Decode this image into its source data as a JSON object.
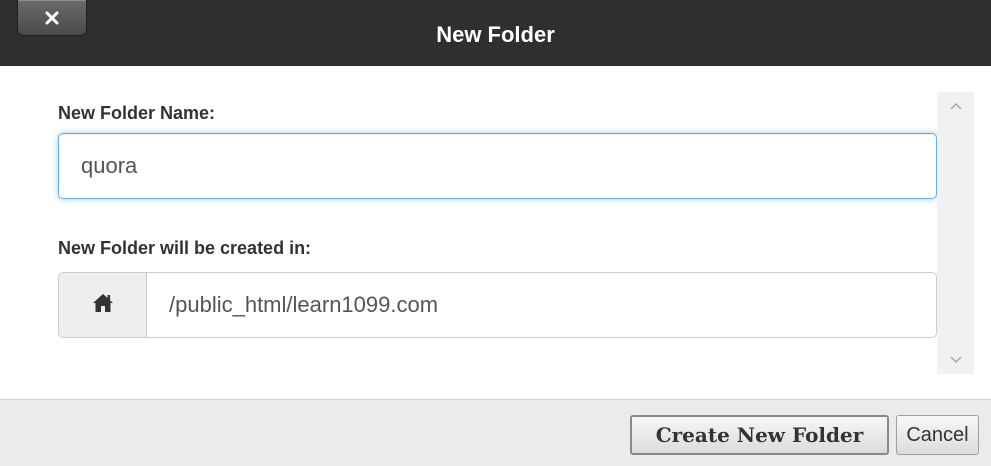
{
  "dialog": {
    "title": "New Folder",
    "close_label": "×"
  },
  "form": {
    "name_label": "New Folder Name:",
    "name_value": "quora",
    "location_label": "New Folder will be created in:",
    "location_icon": "home-icon",
    "location_path": "/public_html/learn1099.com"
  },
  "footer": {
    "create_label": "Create New Folder",
    "cancel_label": "Cancel"
  },
  "colors": {
    "titlebar": "#2f2f2f",
    "focus_border": "#66afe9",
    "footer_bg": "#ebebeb"
  }
}
